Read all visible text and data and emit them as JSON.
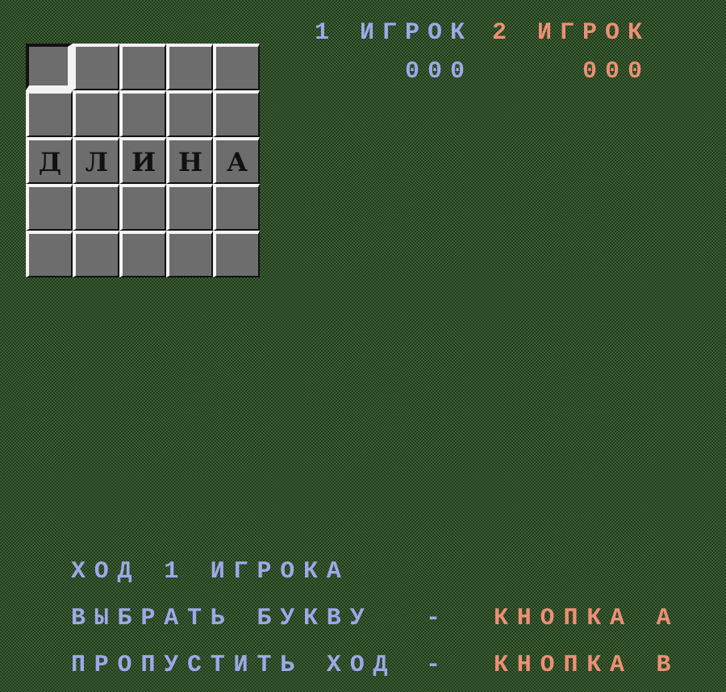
{
  "board": {
    "rows": [
      [
        {
          "selected": true
        },
        {
          "selected": false
        },
        {
          "selected": false
        },
        {
          "selected": false
        },
        {
          "selected": false
        }
      ],
      [
        {
          "selected": false
        },
        {
          "selected": false
        },
        {
          "selected": false
        },
        {
          "selected": false
        },
        {
          "selected": false
        }
      ],
      [
        {
          "selected": false,
          "letter": "Д"
        },
        {
          "selected": false,
          "letter": "Л"
        },
        {
          "selected": false,
          "letter": "И"
        },
        {
          "selected": false,
          "letter": "Н"
        },
        {
          "selected": false,
          "letter": "А"
        }
      ],
      [
        {
          "selected": false
        },
        {
          "selected": false
        },
        {
          "selected": false
        },
        {
          "selected": false
        },
        {
          "selected": false
        }
      ],
      [
        {
          "selected": false
        },
        {
          "selected": false
        },
        {
          "selected": false
        },
        {
          "selected": false
        },
        {
          "selected": false
        }
      ]
    ]
  },
  "players": [
    {
      "label": "1 ИГРОК",
      "score": "000",
      "color": "#9ea8ea"
    },
    {
      "label": "2 ИГРОК",
      "score": "000",
      "color": "#ee8f74"
    }
  ],
  "turn": "ХОД 1 ИГРОКА",
  "controls": [
    {
      "action": "ВЫБРАТЬ БУКВУ",
      "separator": "-",
      "button": "КНОПКА А"
    },
    {
      "action": "ПРОПУСТИТЬ ХОД",
      "separator": "-",
      "button": "КНОПКА В"
    }
  ]
}
